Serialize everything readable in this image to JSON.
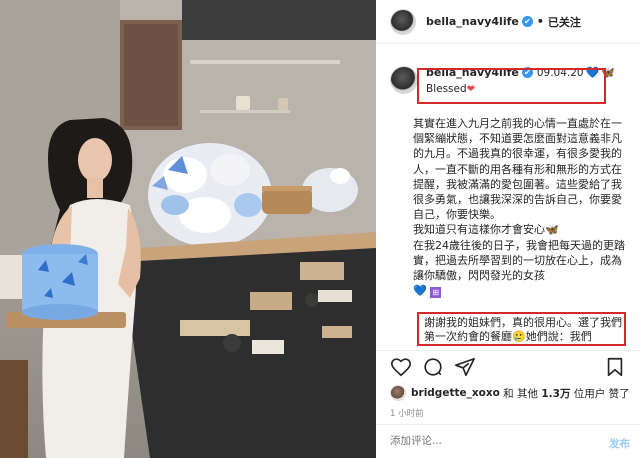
{
  "header": {
    "username": "bella_navy4life",
    "verified_mark": "✔",
    "separator": "•",
    "follow_status": "已关注"
  },
  "caption": {
    "username": "bella_navy4life",
    "date": "09.04.20",
    "emoji_heart": "💙",
    "emoji_butterfly": "🦋",
    "line2_text": "Blessed",
    "line2_emoji": "❤"
  },
  "body_paragraphs": [
    "其實在進入九月之前我的心情一直處於在一個緊繃狀態，不知道要怎麼面對這意義非凡的九月。不過我真的很幸運，有很多愛我的人，一直不斷的用各種有形和無形的方式在提醒，我被滿滿的愛包圍著。這些愛給了我很多勇氣，也讓我深深的告訴自己，你要愛自己，你要快樂。",
    "我知道只有這樣你才會安心🦋",
    "在我24歲往後的日子，我會把每天過的更踏實，把過去所學習到的一切放在心上，成為讓你驕傲，閃閃發光的女孩"
  ],
  "body_end_emoji": "💙",
  "body_end_tag": "⊞",
  "closing_text": "謝謝我的姐妹們，真的很用心。選了我們第一次約會的餐廳🥲她們說：我們",
  "actions": {
    "like_icon": "heart-outline-icon",
    "comment_icon": "comment-icon",
    "share_icon": "share-icon",
    "save_icon": "bookmark-icon"
  },
  "likes": {
    "user": "bridgette_xoxo",
    "middle": " 和 其他 ",
    "count": "1.3万",
    "suffix": " 位用户 赞了"
  },
  "time_ago": "1 小时前",
  "comment": {
    "placeholder": "添加评论...",
    "post_label": "发布"
  },
  "colors": {
    "accent_blue": "#3897f0",
    "highlight_red": "#d62828",
    "muted": "#8e8e8e"
  }
}
